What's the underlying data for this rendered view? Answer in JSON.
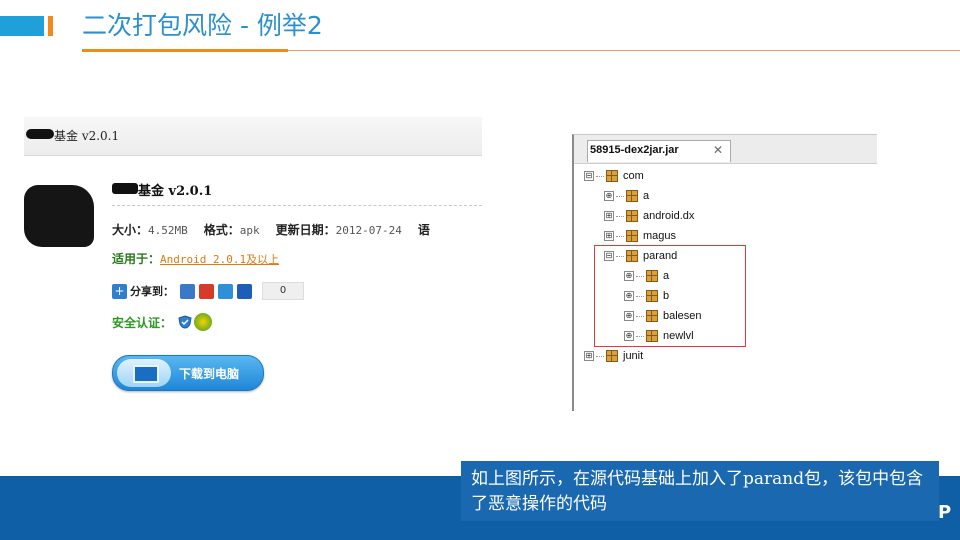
{
  "header": {
    "title": "二次打包风险 - 例举2",
    "accent_color": "#f08a1c",
    "brand_color": "#1fa0d8"
  },
  "app_page": {
    "topbar_title": "基金 v2.0.1",
    "app_name": "基金 v2.0.1",
    "size_label": "大小：",
    "size_value": "4.52MB",
    "format_label": "格式：",
    "format_value": "apk",
    "date_label": "更新日期：",
    "date_value": "2012-07-24",
    "extra_label": "语",
    "fit_label": "适用于：",
    "fit_value": "Android 2.0.1及以上",
    "share_label": "分享到：",
    "share_count": "0",
    "safe_label": "安全认证：",
    "download_label": "下载到电脑"
  },
  "tree": {
    "tab_label": "58915-dex2jar.jar",
    "tab_close": "✕",
    "nodes": [
      {
        "label": "com",
        "expander": "⊟"
      },
      {
        "label": "a",
        "expander": "⊕"
      },
      {
        "label": "android.dx",
        "expander": "⊞"
      },
      {
        "label": "magus",
        "expander": "⊞"
      },
      {
        "label": "parand",
        "expander": "⊟"
      },
      {
        "label": "a",
        "expander": "⊕"
      },
      {
        "label": "b",
        "expander": "⊕"
      },
      {
        "label": "balesen",
        "expander": "⊕"
      },
      {
        "label": "newlvl",
        "expander": "⊕"
      },
      {
        "label": "junit",
        "expander": "⊞"
      }
    ],
    "highlight_color": "#e23a3a"
  },
  "caption": {
    "text": "如上图所示，在源代码基础上加入了parand包，该包中包含了恶意操作的代码"
  },
  "footer": {
    "page_letter": "P"
  }
}
